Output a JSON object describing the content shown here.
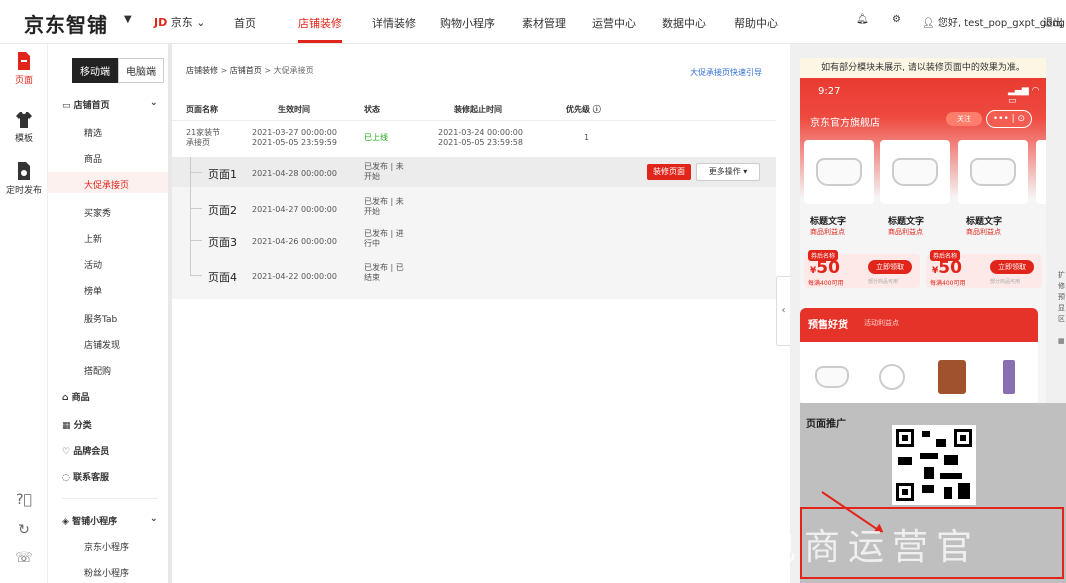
{
  "topbar": {
    "logo": "京东智铺",
    "brand_jd": "JD",
    "brand_name": "京东",
    "nav": [
      "首页",
      "店铺装修",
      "详情装修",
      "购物小程序",
      "素材管理",
      "运营中心",
      "数据中心",
      "帮助中心"
    ],
    "active_nav": "店铺装修",
    "greeting": "您好, test_pop_gxpt_gong",
    "logout": "退出"
  },
  "iconbar": {
    "items": [
      "页面",
      "模板",
      "定时发布"
    ]
  },
  "sidebar": {
    "seg_mobile": "移动端",
    "seg_pc": "电脑端",
    "group_home": "店铺首页",
    "home_items": [
      "精选",
      "商品",
      "大促承接页",
      "买家秀",
      "上新",
      "活动",
      "榜单",
      "服务Tab",
      "店铺发现",
      "搭配购"
    ],
    "selected": "大促承接页",
    "groups": [
      "商品",
      "分类",
      "品牌会员",
      "联系客服"
    ],
    "group_mini": "智铺小程序",
    "mini_items": [
      "京东小程序",
      "粉丝小程序"
    ]
  },
  "main": {
    "breadcrumb": [
      "店铺装修",
      "店铺首页",
      "大促承接页"
    ],
    "guide_link": "大促承接页快速引导",
    "headers": [
      "页面名称",
      "生效时间",
      "状态",
      "装修起止时间",
      "优先级"
    ],
    "parent_row": {
      "name1": "21家装节",
      "name2": "承接页",
      "time1": "2021-03-27 00:00:00",
      "time2": "2021-05-05 23:59:59",
      "status": "已上线",
      "deco1": "2021-03-24 00:00:00",
      "deco2": "2021-05-05 23:59:58",
      "priority": "1"
    },
    "pages": [
      {
        "name": "页面1",
        "time": "2021-04-28 00:00:00",
        "status1": "已发布 | 未",
        "status2": "开始"
      },
      {
        "name": "页面2",
        "time": "2021-04-27 00:00:00",
        "status1": "已发布 | 未",
        "status2": "开始"
      },
      {
        "name": "页面3",
        "time": "2021-04-26 00:00:00",
        "status1": "已发布 | 进",
        "status2": "行中"
      },
      {
        "name": "页面4",
        "time": "2021-04-22 00:00:00",
        "status1": "已发布 | 已",
        "status2": "结束"
      }
    ],
    "btn_decorate": "装修页面",
    "btn_more": "更多操作"
  },
  "preview": {
    "notice": "如有部分模块未展示, 请以装修页面中的效果为准。",
    "time": "9:27",
    "store_name": "京东官方旗舰店",
    "follow": "关注",
    "menu": "••• | ⊙",
    "product_title": "标题文字",
    "product_sub": "商品利益点",
    "coupon_tag": "券后名称",
    "coupon_amount": "50",
    "coupon_currency": "¥",
    "coupon_button": "立即领取",
    "coupon_condition": "每满400可用",
    "coupon_note": "部分商品可用",
    "presale_title": "预售好货",
    "presale_sub": "活动利益点",
    "promo_title": "页面推广",
    "watermark": "电商运营官"
  },
  "colors": {
    "accent": "#e1251b",
    "link": "#2f6fd6",
    "ok": "#1aad19"
  }
}
